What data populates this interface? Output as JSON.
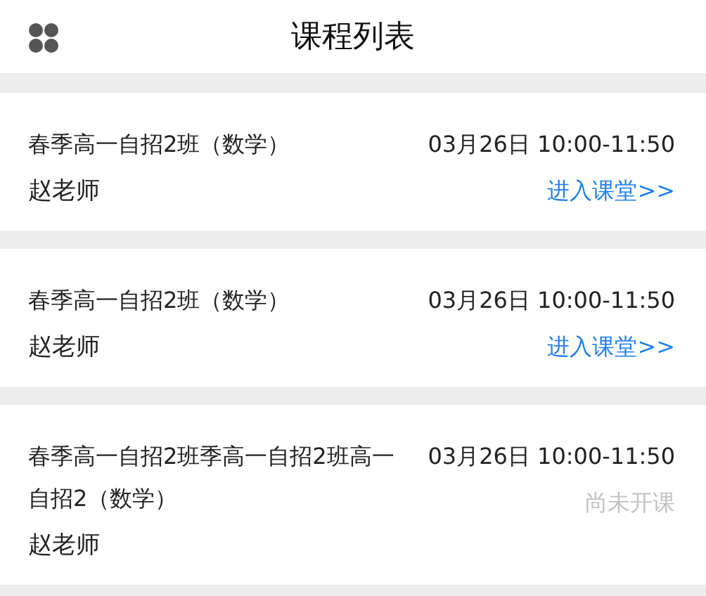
{
  "header": {
    "title": "课程列表"
  },
  "courses": [
    {
      "title": "春季高一自招2班（数学）",
      "teacher": "赵老师",
      "time": "03月26日 10:00-11:50",
      "action": {
        "kind": "enter",
        "label": "进入课堂>>"
      }
    },
    {
      "title": "春季高一自招2班（数学）",
      "teacher": "赵老师",
      "time": "03月26日 10:00-11:50",
      "action": {
        "kind": "enter",
        "label": "进入课堂>>"
      }
    },
    {
      "title": "春季高一自招2班季高一自招2班高一自招2（数学）",
      "teacher": "赵老师",
      "time": "03月26日 10:00-11:50",
      "action": {
        "kind": "not_started",
        "label": "尚未开课"
      }
    }
  ]
}
